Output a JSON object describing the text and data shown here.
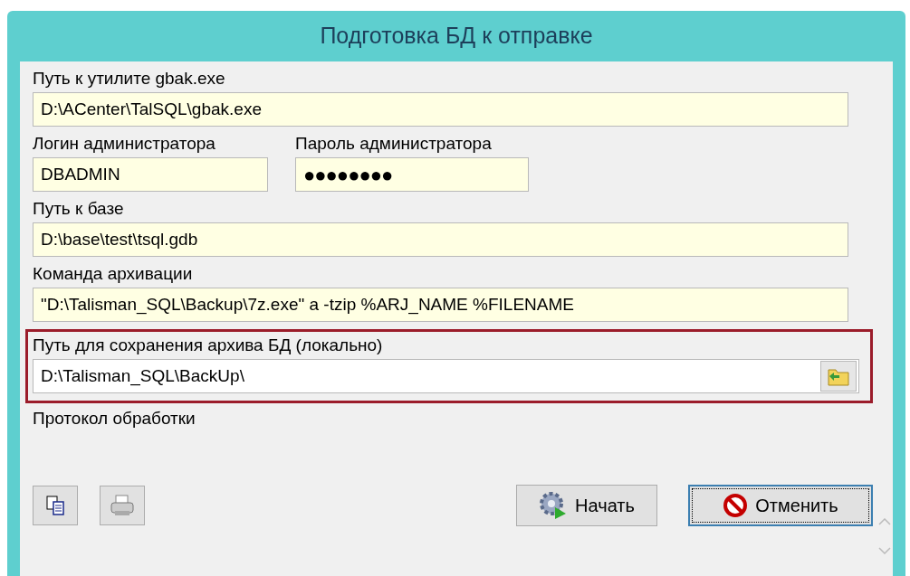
{
  "window": {
    "title": "Подготовка БД к отправке"
  },
  "fields": [
    {
      "label": "Путь к утилите gbak.exe",
      "value": "D:\\ACenter\\TalSQL\\gbak.exe"
    },
    {
      "label": "Логин администратора",
      "value": "DBADMIN"
    },
    {
      "label": "Пароль администратора",
      "value": "●●●●●●●●"
    },
    {
      "label": "Путь к базе",
      "value": "D:\\base\\test\\tsql.gdb"
    },
    {
      "label": "Команда архивации",
      "value": "\"D:\\Talisman_SQL\\Backup\\7z.exe\" a -tzip %ARJ_NAME %FILENAME"
    }
  ],
  "backup_path": {
    "label": "Путь для сохранения архива БД (локально)",
    "value": "D:\\Talisman_SQL\\BackUp\\"
  },
  "log": {
    "label": "Протокол обработки"
  },
  "buttons": [
    {
      "label": "Начать",
      "focused": false
    },
    {
      "label": "Отменить",
      "focused": true
    }
  ]
}
